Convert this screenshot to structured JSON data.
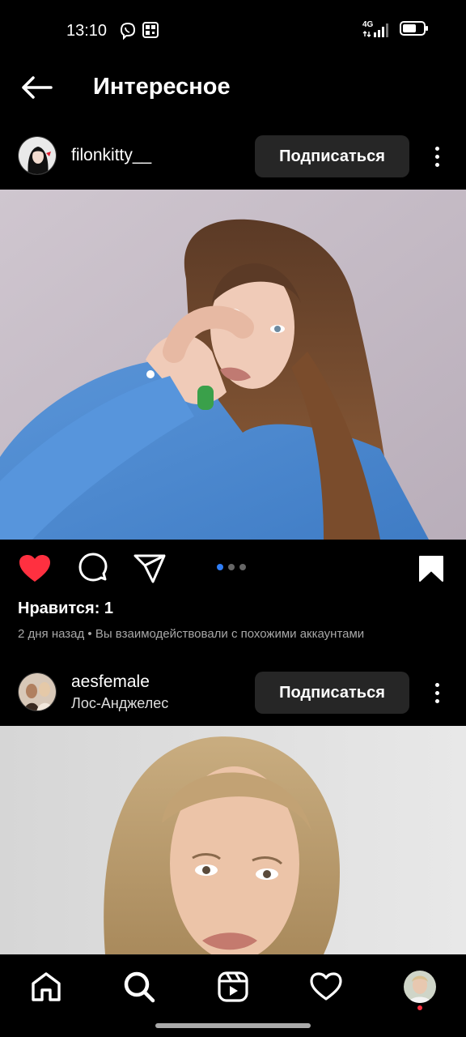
{
  "status_bar": {
    "time": "13:10",
    "network": "4G",
    "app_icons": [
      "viber-icon",
      "qr-icon"
    ]
  },
  "header": {
    "title": "Интересное",
    "back_icon": "arrow-left-icon"
  },
  "posts": [
    {
      "username": "filonkitty__",
      "location": "",
      "follow_label": "Подписаться",
      "likes_label": "Нравится: 1",
      "meta": "2 дня назад • Вы взаимодействовали с похожими аккаунтами",
      "carousel": {
        "count": 3,
        "active": 1
      },
      "liked": true,
      "saved": true
    },
    {
      "username": "aesfemale",
      "location": "Лос-Анджелес",
      "follow_label": "Подписаться"
    }
  ],
  "bottom_nav": {
    "items": [
      "home-icon",
      "search-icon",
      "reels-icon",
      "heart-icon",
      "profile-avatar"
    ],
    "active": "search-icon"
  },
  "colors": {
    "background": "#000000",
    "button_bg": "#262626",
    "like_red": "#ff3040",
    "dot_blue": "#2f7ef7",
    "meta_gray": "#a8a8a8"
  }
}
